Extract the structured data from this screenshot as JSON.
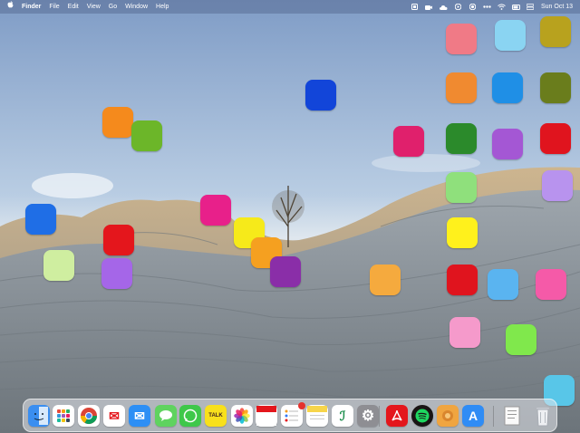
{
  "menubar": {
    "app_name": "Finder",
    "menus": [
      "File",
      "Edit",
      "View",
      "Go",
      "Window",
      "Help"
    ],
    "clock": "Sun Oct 13",
    "status_icons": [
      "menu-extra-icon",
      "camera-icon",
      "cloud-icon",
      "play-icon",
      "record-icon",
      "dots-icon",
      "wifi-icon",
      "battery-icon",
      "control-center-icon"
    ]
  },
  "desktop_icons": [
    {
      "name": "desktop-item-1",
      "color": "#f07a86"
    },
    {
      "name": "desktop-item-2",
      "color": "#8ad4f2"
    },
    {
      "name": "desktop-item-3",
      "color": "#b8a21e"
    },
    {
      "name": "desktop-item-4",
      "color": "#f08a30"
    },
    {
      "name": "desktop-item-5",
      "color": "#1f8fe6"
    },
    {
      "name": "desktop-item-6",
      "color": "#6a7d1c"
    },
    {
      "name": "desktop-item-7",
      "color": "#1245d9"
    },
    {
      "name": "desktop-item-8",
      "color": "#f58a1c"
    },
    {
      "name": "desktop-item-9",
      "color": "#6cb629"
    },
    {
      "name": "desktop-item-10",
      "color": "#e0206c"
    },
    {
      "name": "desktop-item-11",
      "color": "#2b8a2b"
    },
    {
      "name": "desktop-item-12",
      "color": "#a457d4"
    },
    {
      "name": "desktop-item-13",
      "color": "#e0141e"
    },
    {
      "name": "desktop-item-14",
      "color": "#b893ee"
    },
    {
      "name": "desktop-item-15",
      "color": "#8fe07c"
    },
    {
      "name": "desktop-item-16",
      "color": "#1f6ee6"
    },
    {
      "name": "desktop-item-17",
      "color": "#e8208a"
    },
    {
      "name": "desktop-item-18",
      "color": "#f6ea1a"
    },
    {
      "name": "desktop-item-19",
      "color": "#f5a020"
    },
    {
      "name": "desktop-item-20",
      "color": "#e4161c"
    },
    {
      "name": "desktop-item-21",
      "color": "#cfeea0"
    },
    {
      "name": "desktop-item-22",
      "color": "#a566e8"
    },
    {
      "name": "desktop-item-23",
      "color": "#8a2ea8"
    },
    {
      "name": "desktop-item-24",
      "color": "#f5aa3e"
    },
    {
      "name": "desktop-item-25",
      "color": "#fff11c"
    },
    {
      "name": "desktop-item-26",
      "color": "#e0141e"
    },
    {
      "name": "desktop-item-27",
      "color": "#5ab4f0"
    },
    {
      "name": "desktop-item-28",
      "color": "#f55aa8"
    },
    {
      "name": "desktop-item-29",
      "color": "#f59acb"
    },
    {
      "name": "desktop-item-30",
      "color": "#80e84c"
    },
    {
      "name": "desktop-item-31",
      "color": "#58c6e8"
    }
  ],
  "dock": {
    "apps": [
      {
        "name": "finder-icon",
        "color": "#3a8ef0",
        "glyph": ""
      },
      {
        "name": "launchpad-icon",
        "color": "#ffffff",
        "glyph": ""
      },
      {
        "name": "chrome-icon",
        "color": "#ffffff",
        "glyph": ""
      },
      {
        "name": "mail-letter-icon",
        "color": "#ffffff",
        "glyph": "✉"
      },
      {
        "name": "mail-icon",
        "color": "#2d8ff5",
        "glyph": "✉"
      },
      {
        "name": "messages-icon",
        "color": "#5fd35f",
        "glyph": ""
      },
      {
        "name": "whatsapp-icon",
        "color": "#3ec84a",
        "glyph": ""
      },
      {
        "name": "kakaotalk-icon",
        "color": "#f8e01c",
        "glyph": "TALK"
      },
      {
        "name": "photos-icon",
        "color": "#ffffff",
        "glyph": ""
      },
      {
        "name": "calendar-icon",
        "color": "#ffffff",
        "glyph": ""
      },
      {
        "name": "reminders-icon",
        "color": "#ffffff",
        "glyph": ""
      },
      {
        "name": "notes-icon",
        "color": "#ffffff",
        "glyph": ""
      },
      {
        "name": "script-editor-icon",
        "color": "#ffffff",
        "glyph": "ℐ"
      },
      {
        "name": "system-settings-icon",
        "color": "#8e8e93",
        "glyph": "⚙"
      },
      {
        "name": "acrobat-icon",
        "color": "#e4161c",
        "glyph": ""
      },
      {
        "name": "spotify-icon",
        "color": "#1ed760",
        "glyph": ""
      },
      {
        "name": "amber-app-icon",
        "color": "#f0a540",
        "glyph": ""
      },
      {
        "name": "app-store-icon",
        "color": "#2f8cf5",
        "glyph": "A"
      },
      {
        "name": "document-icon",
        "color": "#f2f2f2",
        "glyph": ""
      },
      {
        "name": "trash-icon",
        "color": "#dfe3e8",
        "glyph": ""
      }
    ]
  }
}
